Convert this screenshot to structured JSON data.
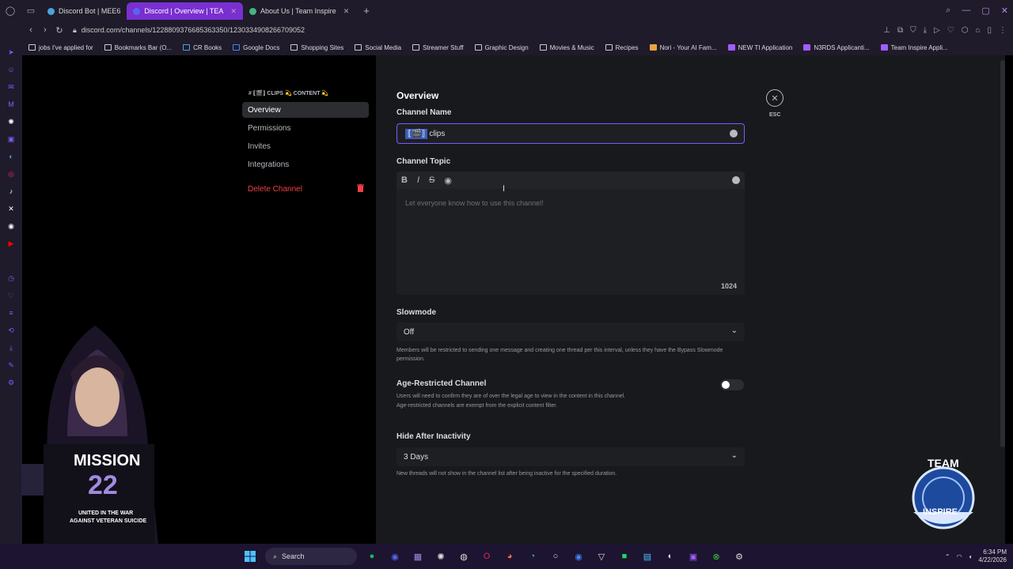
{
  "browser": {
    "tabs": [
      {
        "label": "Discord Bot | MEE6",
        "color": "#4aa3df"
      },
      {
        "label": "Discord | Overview | TEA",
        "color": "#5865f2",
        "active": true
      },
      {
        "label": "About Us | Team Inspire",
        "color": "#43b581"
      }
    ],
    "new_tab": "+",
    "url": "discord.com/channels/1228809376685363350/1230334908266709052",
    "bookmarks": [
      "jobs I've applied for",
      "Bookmarks Bar (O...",
      "CR Books",
      "Google Docs",
      "Shopping Sites",
      "Social Media",
      "Streamer Stuff",
      "Graphic Design",
      "Movies & Music",
      "Recipes",
      "Nori - Your AI Fam...",
      "NEW TI Application",
      "N3RDS Applicanti...",
      "Team Inspire Appli..."
    ]
  },
  "settings_nav": {
    "channel_header": "# ⟦🎬⟧ CLIPS 💫 CONTENT 💫",
    "items": [
      "Overview",
      "Permissions",
      "Invites",
      "Integrations"
    ],
    "delete_label": "Delete Channel"
  },
  "overview": {
    "title": "Overview",
    "channel_name_label": "Channel Name",
    "channel_name_selected": "⟦🎬⟧",
    "channel_name_rest": "clips",
    "topic_label": "Channel Topic",
    "topic_placeholder": "Let everyone know how to use this channel!",
    "topic_counter": "1024",
    "toolbar": {
      "bold": "B",
      "italic": "I",
      "strike": "S",
      "eye": "◉"
    },
    "slowmode_label": "Slowmode",
    "slowmode_value": "Off",
    "slowmode_desc": "Members will be restricted to sending one message and creating one thread per this interval, unless they have the Bypass Slowmode permission.",
    "age_label": "Age-Restricted Channel",
    "age_desc_1": "Users will need to confirm they are of over the legal age to view in the content in this channel.",
    "age_desc_2": "Age-restricted channels are exempt from the explicit content filter.",
    "age_toggle_on": false,
    "inactivity_label": "Hide After Inactivity",
    "inactivity_value": "3 Days",
    "inactivity_desc": "New threads will not show in the channel list after being inactive for the specified duration.",
    "esc_label": "ESC"
  },
  "taskbar": {
    "search_label": "Search",
    "time": "6:34 PM",
    "date": "4/22/2026"
  },
  "overlays": {
    "shirt_line_1": "MISSION",
    "shirt_line_2": "22",
    "shirt_line_3": "UNITED IN THE WAR",
    "shirt_line_4": "AGAINST VETERAN SUICIDE",
    "logo_top": "TEAM",
    "logo_bottom": "INSPIRE"
  },
  "colors": {
    "accent": "#7a5cff",
    "danger": "#f23f43",
    "tab_active": "#7a2fd1"
  }
}
